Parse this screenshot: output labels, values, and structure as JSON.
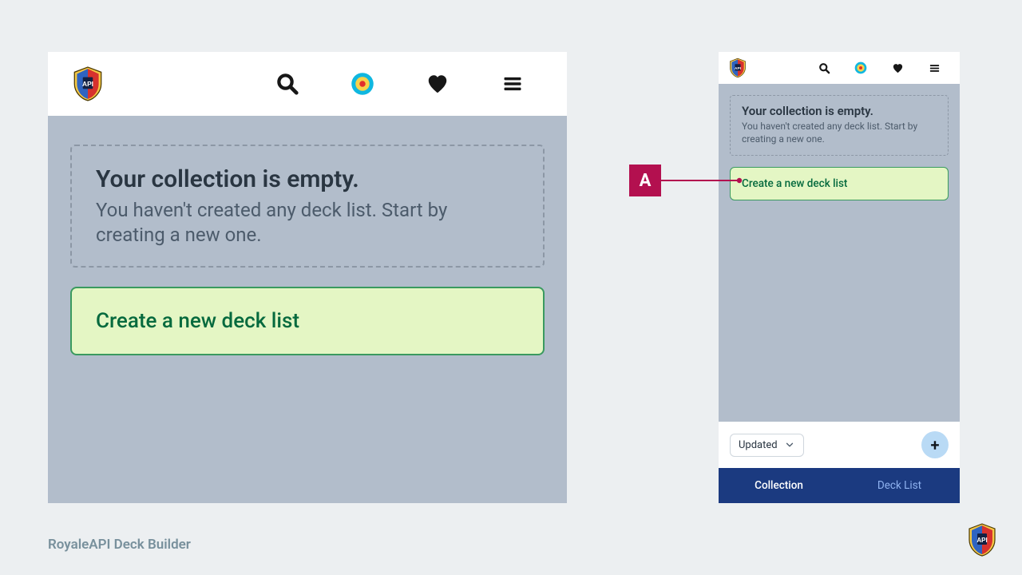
{
  "header": {
    "icons": [
      "search-icon",
      "target-icon",
      "heart-icon",
      "menu-icon"
    ]
  },
  "notice": {
    "title": "Your collection is empty.",
    "message": "You haven't created any deck list. Start by creating a new one."
  },
  "actions": {
    "create_label": "Create a new deck list"
  },
  "footer_small": {
    "sort_value": "Updated",
    "fab_label": "+"
  },
  "tabs": {
    "active": "Collection",
    "inactive": "Deck List"
  },
  "callout": {
    "label": "A"
  },
  "page_caption": "RoyaleAPI Deck Builder"
}
